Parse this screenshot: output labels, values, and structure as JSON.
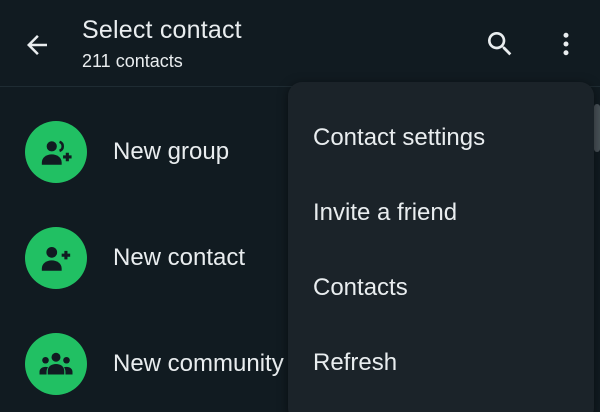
{
  "header": {
    "title": "Select contact",
    "subtitle": "211 contacts",
    "icons": {
      "back": "arrow-left-icon",
      "search": "search-icon",
      "more": "more-vertical-icon"
    }
  },
  "list": {
    "items": [
      {
        "label": "New group",
        "icon": "group-add-icon"
      },
      {
        "label": "New contact",
        "icon": "person-add-icon"
      },
      {
        "label": "New community",
        "icon": "community-icon"
      }
    ]
  },
  "menu": {
    "items": [
      {
        "label": "Contact settings"
      },
      {
        "label": "Invite a friend"
      },
      {
        "label": "Contacts"
      },
      {
        "label": "Refresh"
      }
    ]
  },
  "colors": {
    "background": "#111b21",
    "accent": "#21c063",
    "menu_background": "#1b2329",
    "text": "#e9edef"
  }
}
